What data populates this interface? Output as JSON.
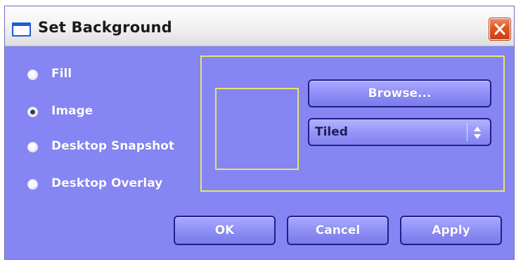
{
  "window": {
    "title": "Set Background",
    "icon": "window-icon",
    "close_icon": "close-icon"
  },
  "source_options": [
    {
      "label": "Fill",
      "selected": false
    },
    {
      "label": "Image",
      "selected": true
    },
    {
      "label": "Desktop Snapshot",
      "selected": false
    },
    {
      "label": "Desktop Overlay",
      "selected": false
    }
  ],
  "image_group": {
    "browse_label": "Browse...",
    "mode_select": {
      "value": "Tiled",
      "icon": "spinner-arrows-icon"
    }
  },
  "buttons": {
    "ok": "OK",
    "cancel": "Cancel",
    "apply": "Apply"
  },
  "colors": {
    "dialog_background": "#8585f4",
    "group_border": "#e8e46a",
    "button_border": "#20208a",
    "close_button": "#e1561f"
  }
}
